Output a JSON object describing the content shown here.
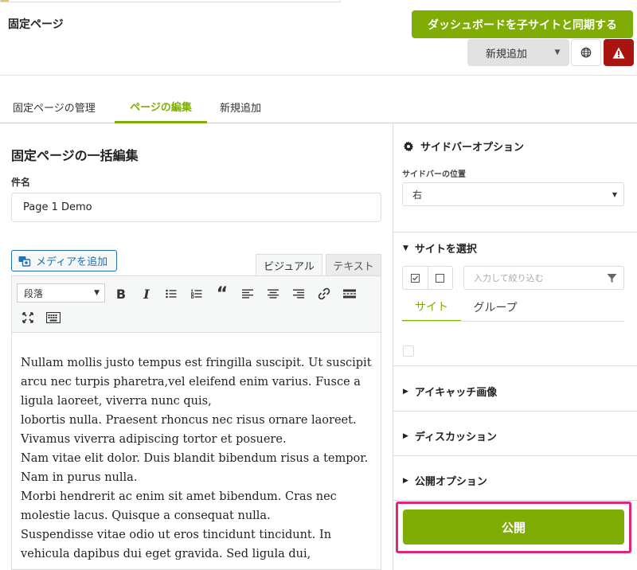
{
  "header": {
    "page_title": "固定ページ",
    "sync_button": "ダッシュボードを子サイトと同期する",
    "new_button": "新規追加"
  },
  "tabs": [
    {
      "label": "固定ページの管理"
    },
    {
      "label": "ページの編集"
    },
    {
      "label": "新規追加"
    }
  ],
  "editor": {
    "heading": "固定ページの一括編集",
    "title_label": "件名",
    "title_value": "Page 1 Demo",
    "media_button": "メディアを追加",
    "mode_visual": "ビジュアル",
    "mode_text": "テキスト",
    "format_select": "段落",
    "content": "Nullam mollis justo tempus est fringilla suscipit. Ut suscipit arcu nec turpis pharetra,vel eleifend enim varius. Fusce a ligula laoreet, viverra nunc quis,\nlobortis nulla. Praesent rhoncus nec risus ornare laoreet. Vivamus viverra adipiscing tortor et posuere.\nNam vitae elit dolor. Duis blandit bibendum risus a tempor. Nam in purus nulla.\nMorbi hendrerit ac enim sit amet bibendum. Cras nec molestie lacus. Quisque a consequat nulla.\nSuspendisse vitae odio ut eros tincidunt tincidunt. In vehicula dapibus dui eget gravida. Sed ligula dui,"
  },
  "sidebar": {
    "options_title": "サイドバーオプション",
    "position_label": "サイドバーの位置",
    "position_value": "右",
    "select_site_title": "サイトを選択",
    "filter_placeholder": "入力して絞り込む",
    "tab_site": "サイト",
    "tab_group": "グループ",
    "featured_image": "アイキャッチ画像",
    "discussion": "ディスカッション",
    "publish_options": "公開オプション",
    "publish_button": "公開"
  },
  "colors": {
    "accent": "#7fad05",
    "alert": "#a91410",
    "highlight": "#e0267a"
  }
}
